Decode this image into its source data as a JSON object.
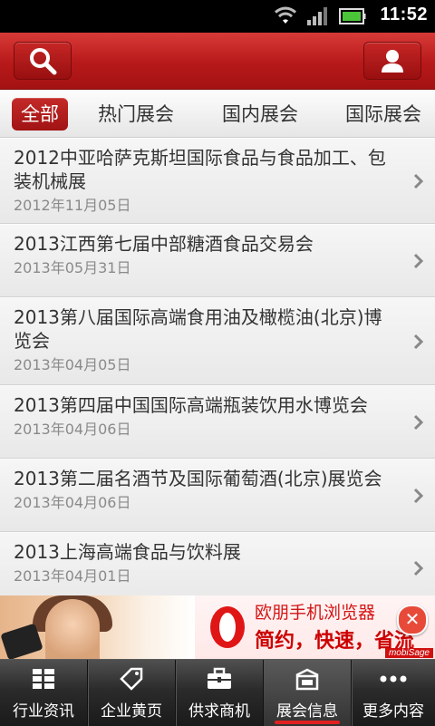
{
  "status_bar": {
    "time": "11:52"
  },
  "header": {
    "left_icon": "search-icon",
    "right_icon": "user-icon"
  },
  "tabs": [
    {
      "label": "全部",
      "active": true
    },
    {
      "label": "热门展会",
      "active": false
    },
    {
      "label": "国内展会",
      "active": false
    },
    {
      "label": "国际展会",
      "active": false
    }
  ],
  "list": [
    {
      "title": "2012中亚哈萨克斯坦国际食品与食品加工、包装机械展",
      "date": "2012年11月05日"
    },
    {
      "title": "2013江西第七届中部糖酒食品交易会",
      "date": "2013年05月31日"
    },
    {
      "title": "2013第八届国际高端食用油及橄榄油(北京)博览会",
      "date": "2013年04月05日"
    },
    {
      "title": "2013第四届中国国际高端瓶装饮用水博览会",
      "date": "2013年04月06日"
    },
    {
      "title": "2013第二届名酒节及国际葡萄酒(北京)展览会",
      "date": "2013年04月06日"
    },
    {
      "title": "2013上海高端食品与饮料展",
      "date": "2013年04月01日"
    }
  ],
  "ad": {
    "line1": "欧朋手机浏览器",
    "line2": "简约，快速，省流量!",
    "close": "✕",
    "badge": "mobiSage"
  },
  "bottom_nav": [
    {
      "label": "行业资讯",
      "icon": "grid-icon",
      "active": false
    },
    {
      "label": "企业黄页",
      "icon": "tag-icon",
      "active": false
    },
    {
      "label": "供求商机",
      "icon": "briefcase-icon",
      "active": false
    },
    {
      "label": "展会信息",
      "icon": "exhibition-icon",
      "active": true
    },
    {
      "label": "更多内容",
      "icon": "more-icon",
      "active": false
    }
  ],
  "colors": {
    "brand_red": "#b7191a",
    "active_underline": "#e02020"
  }
}
